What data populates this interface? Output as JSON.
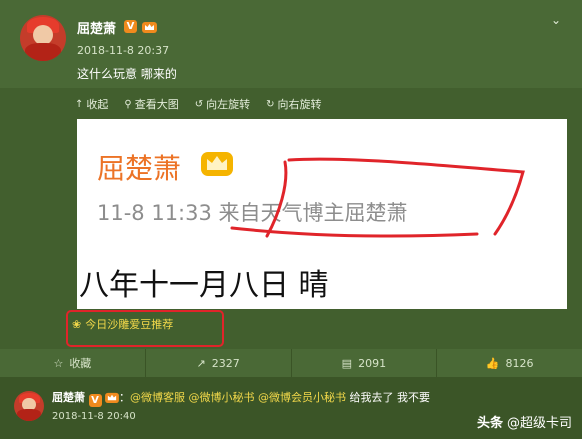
{
  "post": {
    "author": "屈楚萧",
    "time": "2018-11-8 20:37",
    "text": "这什么玩意 哪来的",
    "v_badge": "V"
  },
  "toolbar": {
    "collapse": "收起",
    "view_large": "查看大图",
    "rotate_left": "向左旋转",
    "rotate_right": "向右旋转"
  },
  "image": {
    "name": "屈楚萧",
    "time_source": "11-8 11:33  来自天气博主屈楚萧",
    "line": "八年十一月八日  晴"
  },
  "promo": {
    "icon": "clover-icon",
    "label": "今日沙雕爱豆推荐"
  },
  "actions": {
    "favorite": "收藏",
    "repost_count": "2327",
    "comment_count": "2091",
    "like_count": "8126"
  },
  "comment": {
    "author": "屈楚萧",
    "v_badge": "V",
    "colon": "：",
    "mentions": "@微博客服 @微博小秘书 @微博会员小秘书",
    "text": " 给我去了 我不要",
    "time": "2018-11-8 20:40"
  },
  "watermark": {
    "brand": "头条",
    "handle": "@超级卡司"
  },
  "colors": {
    "accent_red": "#e0242a",
    "name_orange": "#ec7326",
    "link_yellow": "#f2d84a"
  }
}
